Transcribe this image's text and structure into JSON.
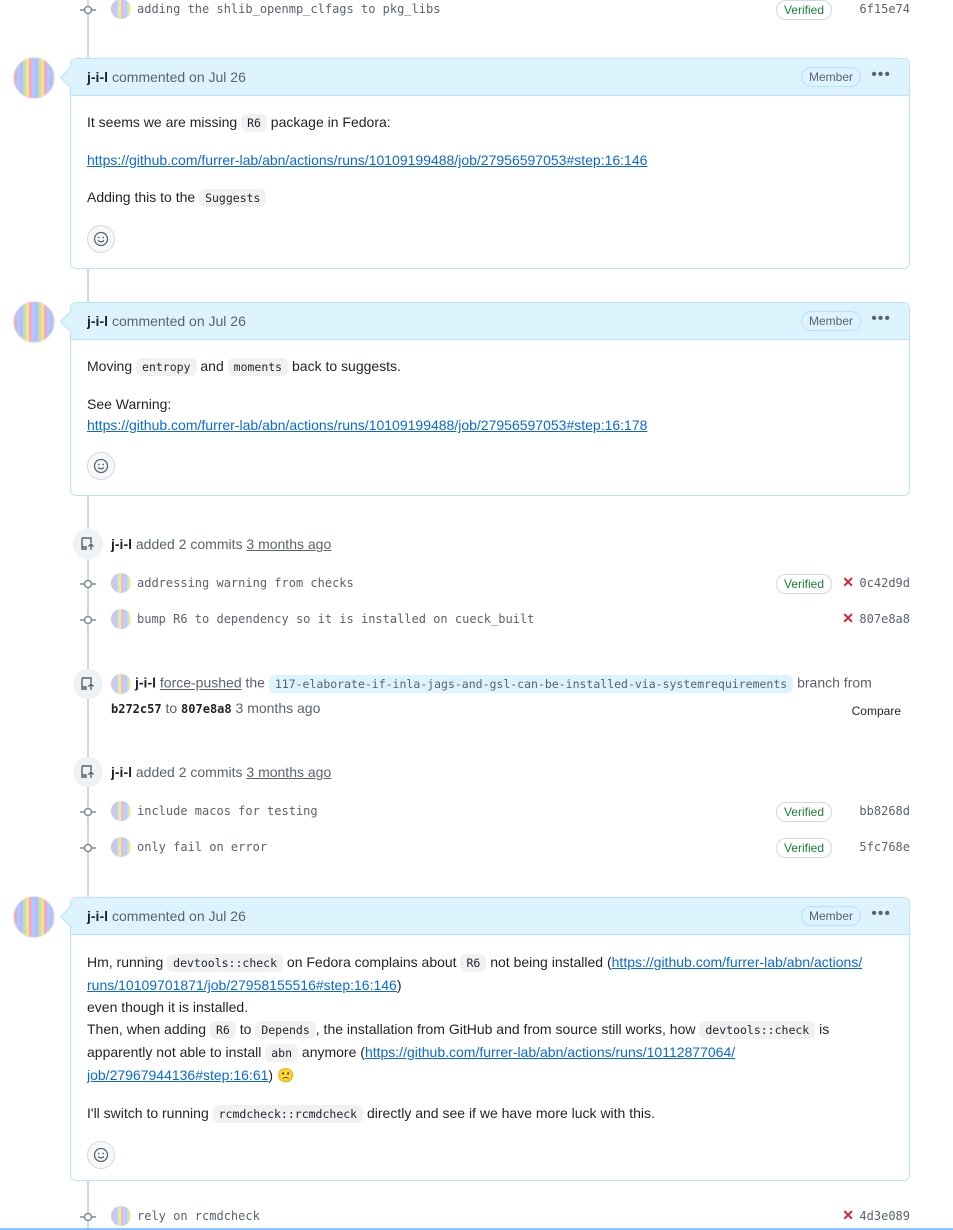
{
  "timeline": {
    "top_commit": {
      "message": "adding the shlib_openmp_clfags to pkg_libs",
      "verified": "Verified",
      "sha": "6f15e74"
    },
    "comments": [
      {
        "author": "j-i-l",
        "meta": "commented on Jul 26",
        "badge": "Member",
        "more": "•••",
        "p1_pre": "It seems we are missing ",
        "p1_code": "R6",
        "p1_post": " package in Fedora:",
        "link1": "https://github.com/furrer-lab/abn/actions/runs/10109199488/job/27956597053#step:16:146",
        "p3_pre": "Adding this to the ",
        "p3_code": "Suggests"
      },
      {
        "author": "j-i-l",
        "meta": "commented on Jul 26",
        "badge": "Member",
        "more": "•••",
        "p1_pre": "Moving ",
        "p1_code1": "entropy",
        "p1_mid": " and ",
        "p1_code2": "moments",
        "p1_post": " back to suggests.",
        "p2": "See Warning:",
        "link1": "https://github.com/furrer-lab/abn/actions/runs/10109199488/job/27956597053#step:16:178"
      },
      {
        "author": "j-i-l",
        "meta": "commented on Jul 26",
        "badge": "Member",
        "more": "•••",
        "l1_pre": "Hm, running ",
        "l1_code1": "devtools::check",
        "l1_mid": " on Fedora complains about ",
        "l1_code2": "R6",
        "l1_post": " not being installed (",
        "link1a": "https://github.com/furrer-lab/abn/actions/",
        "link1b": "runs/10109701871/job/27958155516#step:16:146",
        "l2_close": ")",
        "l3": "even though it is installed.",
        "l4_pre": "Then, when adding ",
        "l4_code1": "R6",
        "l4_mid": " to ",
        "l4_code2": "Depends",
        "l4_post": ", the installation from GitHub and from source still works, how ",
        "l4_code3": "devtools::check",
        "l4_end": " is",
        "l5_pre": "apparently not able to install ",
        "l5_code": "abn",
        "l5_post": " anymore (",
        "link2a": "https://github.com/furrer-lab/abn/actions/runs/10112877064/",
        "link2b": "job/27967944136#step:16:61",
        "l6_close": ") ",
        "emoji": "🙁",
        "p2_pre": "I'll switch to running ",
        "p2_code": "rcmdcheck::rcmdcheck",
        "p2_post": " directly and see if we have more luck with this."
      }
    ],
    "event1": {
      "author": "j-i-l",
      "action": " added 2 commits ",
      "time": "3 months ago"
    },
    "commits1": [
      {
        "message": "addressing warning from checks",
        "verified": "Verified",
        "status": "✕",
        "sha": "0c42d9d"
      },
      {
        "message": "bump R6 to dependency so it is installed on cueck_built",
        "status": "✕",
        "sha": "807e8a8"
      }
    ],
    "force_push": {
      "author": "j-i-l",
      "action": "force-pushed",
      "the": " the ",
      "branch": "117-elaborate-if-inla-jags-and-gsl-can-be-installed-via-systemrequirements",
      "branch_from": " branch from",
      "from_sha": "b272c57",
      "to": " to ",
      "to_sha": "807e8a8",
      "time": " 3 months ago",
      "compare": "Compare"
    },
    "event2": {
      "author": "j-i-l",
      "action": " added 2 commits ",
      "time": "3 months ago"
    },
    "commits2": [
      {
        "message": "include macos for testing",
        "verified": "Verified",
        "sha": "bb8268d"
      },
      {
        "message": "only fail on error",
        "verified": "Verified",
        "sha": "5fc768e"
      }
    ],
    "bottom_commit": {
      "message": "rely on rcmdcheck",
      "status": "✕",
      "sha": "4d3e089"
    }
  }
}
